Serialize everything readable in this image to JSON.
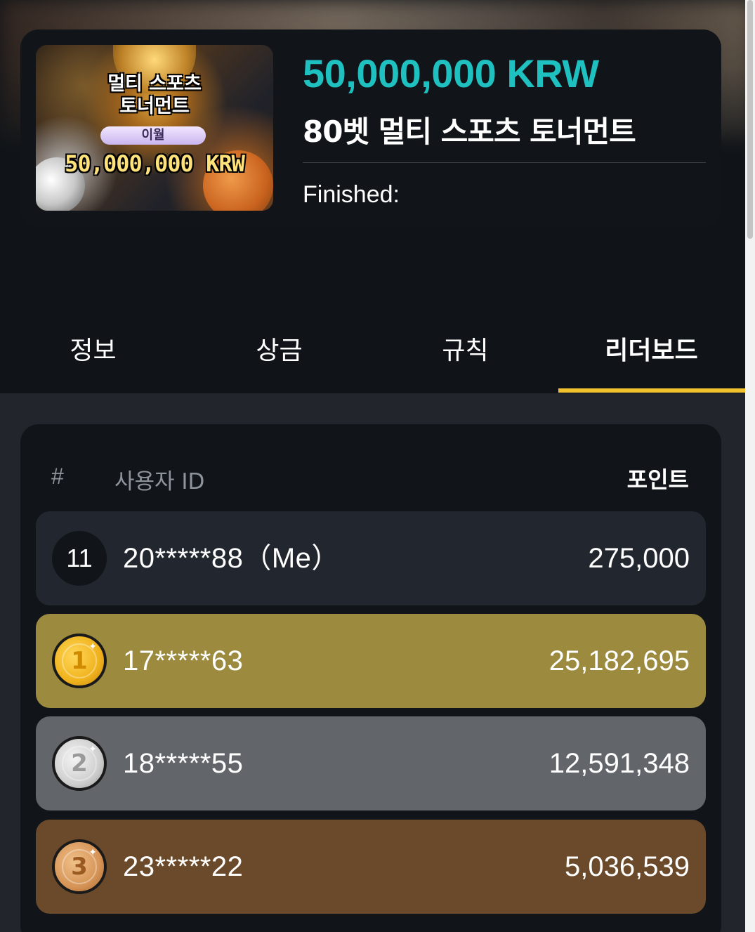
{
  "tournament": {
    "thumb": {
      "title_line1": "멀티 스포츠",
      "title_line2": "토너먼트",
      "pill": "이월",
      "amount": "50,000,000 KRW"
    },
    "prize": "50,000,000 KRW",
    "name": "80벳 멀티 스포츠 토너먼트",
    "status": "Finished:"
  },
  "tabs": [
    {
      "label": "정보",
      "active": false
    },
    {
      "label": "상금",
      "active": false
    },
    {
      "label": "규칙",
      "active": false
    },
    {
      "label": "리더보드",
      "active": true
    }
  ],
  "leaderboard": {
    "headers": {
      "rank": "#",
      "user": "사용자 ID",
      "points": "포인트"
    },
    "me": {
      "rank": "11",
      "user": "20*****88（Me）",
      "points": "275,000"
    },
    "rows": [
      {
        "rank": "1",
        "user": "17*****63",
        "points": "25,182,695",
        "medal": "gold"
      },
      {
        "rank": "2",
        "user": "18*****55",
        "points": "12,591,348",
        "medal": "silver"
      },
      {
        "rank": "3",
        "user": "23*****22",
        "points": "5,036,539",
        "medal": "bronze"
      }
    ]
  },
  "colors": {
    "accent_prize": "#1fc0c0",
    "tab_underline": "#f2c12e",
    "gold_row": "#9c8a3e",
    "silver_row": "#62656a",
    "bronze_row": "#6a4a2a"
  }
}
